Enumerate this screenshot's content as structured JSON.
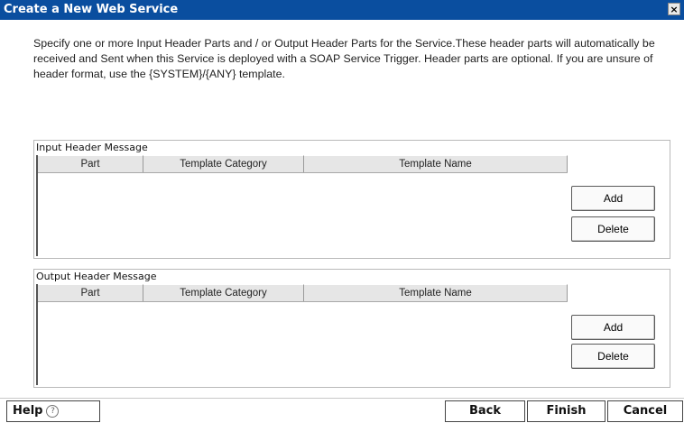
{
  "window": {
    "title": "Create a New Web Service",
    "close_glyph": "×"
  },
  "description": "Specify one or more Input Header Parts and / or Output Header Parts for the Service.These header parts will automatically be received and Sent when this Service is deployed with a SOAP Service Trigger. Header parts are optional. If you are unsure of header format, use the {SYSTEM}/{ANY} template.",
  "input_section": {
    "label": "Input Header Message",
    "columns": [
      "Part",
      "Template Category",
      "Template Name"
    ],
    "rows": [],
    "add_label": "Add",
    "delete_label": "Delete"
  },
  "output_section": {
    "label": "Output Header Message",
    "columns": [
      "Part",
      "Template Category",
      "Template Name"
    ],
    "rows": [],
    "add_label": "Add",
    "delete_label": "Delete"
  },
  "footer": {
    "help_label": "Help",
    "help_icon": "?",
    "back_label": "Back",
    "finish_label": "Finish",
    "cancel_label": "Cancel"
  },
  "colors": {
    "titlebar": "#0a4e9f",
    "header_bg": "#e6e6e6"
  }
}
